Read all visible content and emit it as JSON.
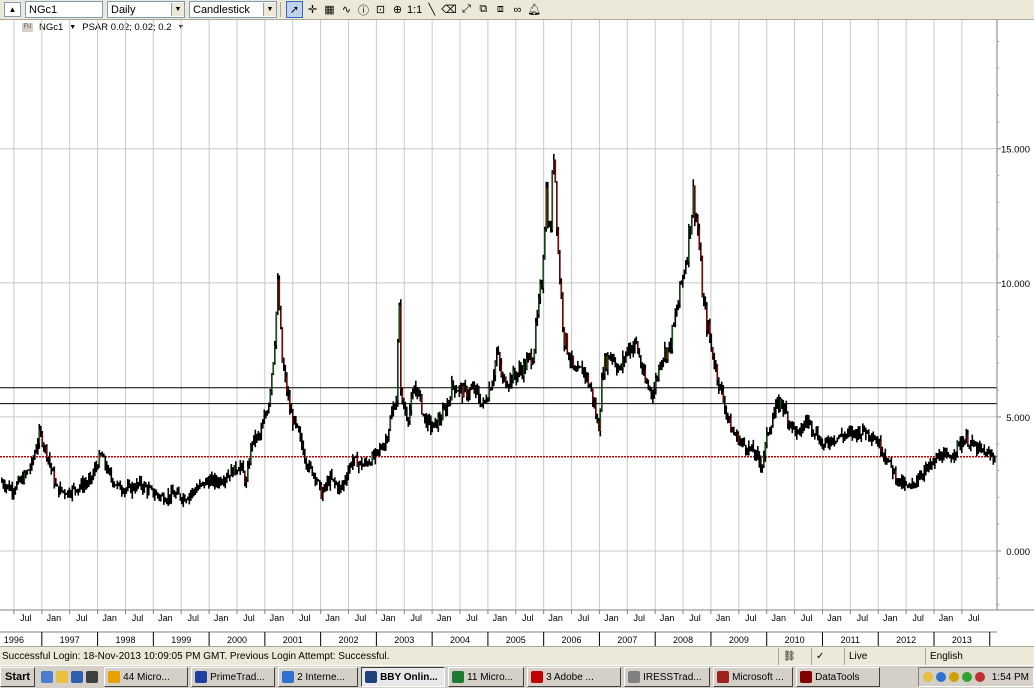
{
  "toolbar": {
    "symbol": "NGc1",
    "period": "Daily",
    "chart_style": "Candlestick",
    "zoom_reset_label": "1:1"
  },
  "legend": {
    "symbol": "NGc1",
    "indicator": "PSAR 0.02; 0.02; 0.2"
  },
  "chart_data": {
    "type": "line",
    "series": [
      {
        "values": [
          [
            1996.0,
            2.6
          ],
          [
            1996.2,
            2.3
          ],
          [
            1996.4,
            2.7
          ],
          [
            1996.55,
            3.2
          ],
          [
            1996.7,
            4.4
          ],
          [
            1996.85,
            3.5
          ],
          [
            1997.0,
            2.3
          ],
          [
            1997.2,
            2.2
          ],
          [
            1997.4,
            2.4
          ],
          [
            1997.6,
            2.6
          ],
          [
            1997.8,
            3.6
          ],
          [
            1997.95,
            2.8
          ],
          [
            1998.1,
            2.4
          ],
          [
            1998.3,
            2.3
          ],
          [
            1998.5,
            2.5
          ],
          [
            1998.7,
            2.2
          ],
          [
            1998.9,
            2.0
          ],
          [
            1999.1,
            2.1
          ],
          [
            1999.3,
            2.0
          ],
          [
            1999.5,
            2.3
          ],
          [
            1999.7,
            2.6
          ],
          [
            1999.9,
            2.6
          ],
          [
            2000.1,
            2.9
          ],
          [
            2000.3,
            3.2
          ],
          [
            2000.4,
            2.5
          ],
          [
            2000.5,
            4.1
          ],
          [
            2000.65,
            4.3
          ],
          [
            2000.8,
            5.5
          ],
          [
            2000.9,
            7.5
          ],
          [
            2000.97,
            9.9
          ],
          [
            2001.05,
            7.0
          ],
          [
            2001.2,
            5.1
          ],
          [
            2001.35,
            4.3
          ],
          [
            2001.5,
            3.2
          ],
          [
            2001.65,
            2.8
          ],
          [
            2001.75,
            2.1
          ],
          [
            2001.9,
            2.7
          ],
          [
            2002.1,
            2.3
          ],
          [
            2002.3,
            3.4
          ],
          [
            2002.5,
            3.2
          ],
          [
            2002.7,
            3.5
          ],
          [
            2002.9,
            4.1
          ],
          [
            2003.0,
            5.0
          ],
          [
            2003.1,
            5.8
          ],
          [
            2003.14,
            9.5
          ],
          [
            2003.18,
            5.6
          ],
          [
            2003.3,
            5.0
          ],
          [
            2003.45,
            6.2
          ],
          [
            2003.6,
            4.9
          ],
          [
            2003.75,
            4.6
          ],
          [
            2003.9,
            5.0
          ],
          [
            2004.0,
            5.4
          ],
          [
            2004.1,
            6.2
          ],
          [
            2004.3,
            5.9
          ],
          [
            2004.5,
            6.0
          ],
          [
            2004.65,
            5.4
          ],
          [
            2004.8,
            6.3
          ],
          [
            2004.9,
            7.4
          ],
          [
            2005.0,
            6.3
          ],
          [
            2005.2,
            6.5
          ],
          [
            2005.4,
            6.9
          ],
          [
            2005.55,
            7.4
          ],
          [
            2005.7,
            10.0
          ],
          [
            2005.78,
            13.5
          ],
          [
            2005.85,
            11.5
          ],
          [
            2005.92,
            15.2
          ],
          [
            2006.0,
            11.0
          ],
          [
            2006.1,
            8.0
          ],
          [
            2006.2,
            7.3
          ],
          [
            2006.3,
            6.5
          ],
          [
            2006.45,
            6.8
          ],
          [
            2006.6,
            5.9
          ],
          [
            2006.72,
            4.5
          ],
          [
            2006.8,
            6.9
          ],
          [
            2006.95,
            7.4
          ],
          [
            2007.1,
            6.7
          ],
          [
            2007.25,
            7.6
          ],
          [
            2007.4,
            7.7
          ],
          [
            2007.55,
            6.3
          ],
          [
            2007.7,
            5.9
          ],
          [
            2007.85,
            7.3
          ],
          [
            2008.0,
            7.6
          ],
          [
            2008.15,
            9.3
          ],
          [
            2008.3,
            11.1
          ],
          [
            2008.42,
            13.3
          ],
          [
            2008.5,
            12.0
          ],
          [
            2008.6,
            9.2
          ],
          [
            2008.75,
            7.5
          ],
          [
            2008.9,
            6.1
          ],
          [
            2009.1,
            4.5
          ],
          [
            2009.3,
            4.0
          ],
          [
            2009.5,
            3.7
          ],
          [
            2009.65,
            3.2
          ],
          [
            2009.75,
            4.4
          ],
          [
            2009.9,
            5.3
          ],
          [
            2010.0,
            5.6
          ],
          [
            2010.1,
            5.0
          ],
          [
            2010.3,
            4.3
          ],
          [
            2010.45,
            4.9
          ],
          [
            2010.6,
            4.5
          ],
          [
            2010.75,
            3.9
          ],
          [
            2010.9,
            4.2
          ],
          [
            2011.1,
            4.3
          ],
          [
            2011.3,
            4.4
          ],
          [
            2011.5,
            4.5
          ],
          [
            2011.65,
            4.3
          ],
          [
            2011.8,
            3.8
          ],
          [
            2011.95,
            3.2
          ],
          [
            2012.1,
            2.6
          ],
          [
            2012.3,
            2.3
          ],
          [
            2012.5,
            2.9
          ],
          [
            2012.7,
            3.2
          ],
          [
            2012.85,
            3.6
          ],
          [
            2013.0,
            3.4
          ],
          [
            2013.15,
            3.9
          ],
          [
            2013.3,
            4.2
          ],
          [
            2013.45,
            3.9
          ],
          [
            2013.6,
            3.7
          ],
          [
            2013.8,
            3.5
          ]
        ]
      }
    ],
    "y_ticks": [
      "15.000",
      "10.000",
      "5.000",
      "0.000"
    ],
    "ylim": [
      -2.2,
      19.8
    ],
    "xlim": [
      1996.0,
      2013.88
    ],
    "month_labels": [
      "Jul",
      "Jan",
      "Jul",
      "Jan",
      "Jul",
      "Jan",
      "Jul",
      "Jan",
      "Jul",
      "Jan",
      "Jul",
      "Jan",
      "Jul",
      "Jan",
      "Jul",
      "Jan",
      "Jul",
      "Jan",
      "Jul",
      "Jan",
      "Jul",
      "Jan",
      "Jul",
      "Jan",
      "Jul",
      "Jan",
      "Jul",
      "Jan",
      "Jul",
      "Jan",
      "Jul",
      "Jan",
      "Jul",
      "Jan",
      "Jul"
    ],
    "year_labels": [
      "1996",
      "1997",
      "1998",
      "1999",
      "2000",
      "2001",
      "2002",
      "2003",
      "2004",
      "2005",
      "2006",
      "2007",
      "2008",
      "2009",
      "2010",
      "2011",
      "2012",
      "2013"
    ],
    "horizontal_lines": [
      {
        "value": 6.089,
        "label": "6.089",
        "style": "solid",
        "color": "#000000"
      },
      {
        "value": 5.494,
        "label": "5.494",
        "style": "solid",
        "color": "#000000"
      },
      {
        "value": 3.515,
        "label": "3.515",
        "style": "dotted",
        "color": "#cc0000"
      }
    ],
    "colors": {
      "bars": "#000000",
      "up": "#1a7a1a",
      "down": "#cc0000",
      "grid": "#c8c8c8"
    },
    "grid": true
  },
  "status": {
    "message": "Successful Login: 18-Nov-2013 10:09:05 PM GMT. Previous Login Attempt: Successful.",
    "connection": "Live",
    "language": "English"
  },
  "taskbar": {
    "start": "Start",
    "tasks": [
      {
        "label": "44 Micro...",
        "color": "#e8a000"
      },
      {
        "label": "PrimeTrad...",
        "color": "#2040a0"
      },
      {
        "label": "2 Interne...",
        "color": "#3070d0"
      },
      {
        "label": "BBY Onlin...",
        "color": "#204080"
      },
      {
        "label": "11 Micro...",
        "color": "#1e7b34"
      },
      {
        "label": "3 Adobe ...",
        "color": "#c00000"
      },
      {
        "label": "IRESSTrad...",
        "color": "#808080"
      },
      {
        "label": "Microsoft ...",
        "color": "#a02020"
      },
      {
        "label": "DataTools",
        "color": "#800000"
      }
    ],
    "clock": "1:54 PM"
  }
}
